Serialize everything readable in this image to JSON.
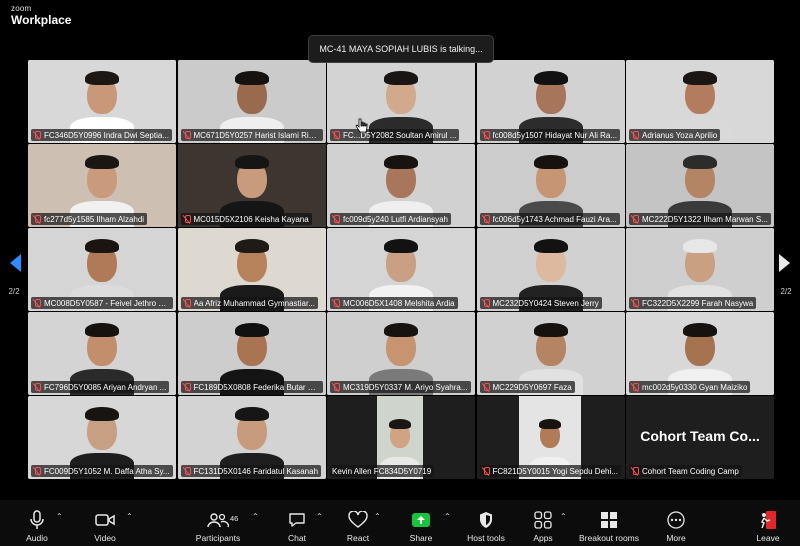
{
  "app": {
    "logo_small": "zoom",
    "logo_big": "Workplace"
  },
  "talking_indicator": "MC-41 MAYA SOPIAH LUBIS is talking...",
  "pagination": {
    "left": "2/2",
    "right": "2/2"
  },
  "participants": [
    {
      "name": "FC346D5Y0996 Indra Dwi Septia...",
      "bg": "#d8d8d8",
      "skin": "#c99878",
      "hair": "#1d1714",
      "shirt": "#ffffff",
      "muted": true
    },
    {
      "name": "MC671D5Y0257 Harist Islami Rid...",
      "bg": "#cbcbcb",
      "skin": "#9a6a4e",
      "hair": "#161210",
      "shirt": "#efefef",
      "muted": true
    },
    {
      "name": "FC...D5Y2082 Soultan Amirul ...",
      "bg": "#d3d3d3",
      "skin": "#d1a98c",
      "hair": "#1a1513",
      "shirt": "#2b2b2b",
      "muted": true
    },
    {
      "name": "fc008d5y1507 Hidayat Nur Ali Ra...",
      "bg": "#d2d2d2",
      "skin": "#a7755a",
      "hair": "#111",
      "shirt": "#2c2c2c",
      "muted": true
    },
    {
      "name": "Adrianus Yoza Aprilio",
      "bg": "#d8d8d8",
      "skin": "#b37c5e",
      "hair": "#1b1614",
      "shirt": "#d9d9d9",
      "muted": true
    },
    {
      "name": "fc277d5y1585 Ilham Alzahdi",
      "bg": "#cdbfb2",
      "skin": "#c99a7b",
      "hair": "#1c1612",
      "shirt": "#f1f1f1",
      "muted": true
    },
    {
      "name": "MC015D5X2106 Keisha Kayana",
      "bg": "#3c3530",
      "skin": "#c89b7c",
      "hair": "#151515",
      "shirt": "#151515",
      "muted": true
    },
    {
      "name": "fc009d5y240 Lutfi Ardiansyah",
      "bg": "#d1d1d1",
      "skin": "#a8765a",
      "hair": "#181311",
      "shirt": "#efefef",
      "muted": true
    },
    {
      "name": "fc006d5y1743 Achmad Fauzi Ara...",
      "bg": "#cccccc",
      "skin": "#c69574",
      "hair": "#161210",
      "shirt": "#4a4a4a",
      "muted": true
    },
    {
      "name": "MC222D5Y1322 Ilham Marwan S...",
      "bg": "#c4c4c4",
      "skin": "#b48565",
      "hair": "#2c2c2a",
      "shirt": "#3a3a3a",
      "muted": true
    },
    {
      "name": "MC008D5Y0587 - Feivel Jethro E...",
      "bg": "#d5d5d5",
      "skin": "#b07a58",
      "hair": "#1b1512",
      "shirt": "#dcdcdc",
      "muted": true
    },
    {
      "name": "Aa Afriz Muhammad Gymnastiar...",
      "bg": "#ddd8d0",
      "skin": "#b5825c",
      "hair": "#201a16",
      "shirt": "#1a1a1a",
      "muted": true
    },
    {
      "name": "MC006D5X1408 Melshita Ardia",
      "bg": "#d5d5d5",
      "skin": "#c9a084",
      "hair": "#121212",
      "shirt": "#f2f2f2",
      "muted": true
    },
    {
      "name": "MC232D5Y0424 Steven Jerry",
      "bg": "#d1d1d1",
      "skin": "#dcb99f",
      "hair": "#121212",
      "shirt": "#222",
      "muted": true
    },
    {
      "name": "FC322D5X2299 Farah Nasywa",
      "bg": "#cfcfcf",
      "skin": "#caa082",
      "hair": "#e7e7e7",
      "shirt": "#e2e2e2",
      "muted": true
    },
    {
      "name": "FC796D5Y0085 Ariyan Andryan ...",
      "bg": "#d4d4d4",
      "skin": "#c28e6c",
      "hair": "#161210",
      "shirt": "#2a2a2a",
      "muted": true
    },
    {
      "name": "FC189D5X0808 Federika Butar B...",
      "bg": "#cdcdcd",
      "skin": "#a87452",
      "hair": "#111",
      "shirt": "#141414",
      "muted": true
    },
    {
      "name": "MC319D5Y0337 M. Ariyo Syahra...",
      "bg": "#cfcfcf",
      "skin": "#c6946f",
      "hair": "#171310",
      "shirt": "#7a7a7a",
      "muted": true
    },
    {
      "name": "MC229D5Y0697 Faza",
      "bg": "#d1d1d1",
      "skin": "#b58462",
      "hair": "#151210",
      "shirt": "#e1e1e1",
      "muted": true
    },
    {
      "name": "mc002d5y0330 Gyan Maiziko",
      "bg": "#d8d8d8",
      "skin": "#a67350",
      "hair": "#161210",
      "shirt": "#f0f0f0",
      "muted": true
    },
    {
      "name": "FC009D5Y1052 M. Daffa Atha Sy...",
      "bg": "#d7d7d7",
      "skin": "#c7a083",
      "hair": "#181411",
      "shirt": "#1d1d1d",
      "muted": true
    },
    {
      "name": "FC131D5X0146 Faridatul Kasanah",
      "bg": "#d3d3d3",
      "skin": "#c79b7c",
      "hair": "#161616",
      "shirt": "#1e1e1e",
      "muted": true
    },
    {
      "name": "Kevin Allen FC834D5Y0719",
      "bg": "#1e1e1e",
      "skin": "#cfa384",
      "hair": "#1a1614",
      "shirt": "#e8e8e8",
      "muted": false
    },
    {
      "name": "FC821D5Y0015 Yogi Sepdu Dehi...",
      "bg": "#1e1e1e",
      "skin": "#b07c58",
      "hair": "#171310",
      "shirt": "#f1f1f1",
      "muted": true
    },
    {
      "name": "Cohort Team Coding Camp",
      "bg": "#1e1e1e",
      "skin": "",
      "hair": "",
      "shirt": "",
      "muted": true,
      "display_text": "Cohort Team Co..."
    }
  ],
  "toolbar": {
    "audio": "Audio",
    "video": "Video",
    "participants": "Participants",
    "participants_count": "46",
    "chat": "Chat",
    "react": "React",
    "share": "Share",
    "host_tools": "Host tools",
    "apps": "Apps",
    "breakout_rooms": "Breakout rooms",
    "more": "More",
    "leave": "Leave"
  },
  "colors": {
    "share_green": "#17c43b",
    "leave_red": "#e02828",
    "muted_red": "#ff4d4f",
    "nav_blue": "#2d8cff"
  }
}
